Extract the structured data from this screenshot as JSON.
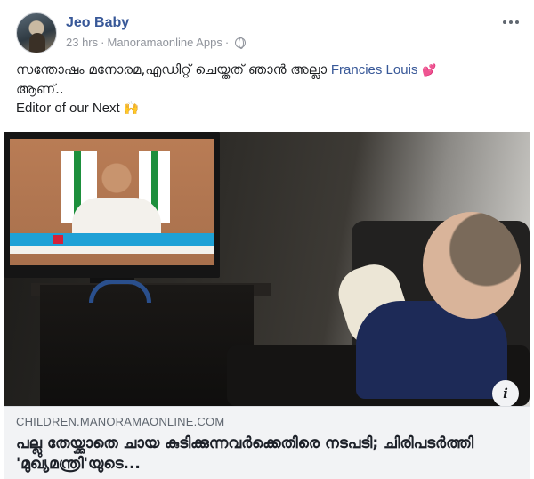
{
  "post": {
    "author": "Jeo Baby",
    "time": "23 hrs",
    "separator": "·",
    "app": "Manoramaonline Apps",
    "privacy_icon": "globe-icon",
    "more_icon": "more-horizontal-icon",
    "text": {
      "line1": "സന്തോഷം മനോരമ,എഡിറ്റ് ചെയ്തത് ഞാൻ അല്ലാ",
      "mention": "Francies Louis",
      "heart_emoji": "💕",
      "line2": "ആണ്..",
      "line3": "Editor of our Next",
      "hands_emoji": "🙌"
    }
  },
  "link_preview": {
    "info_icon": "info-icon",
    "info_label": "i",
    "domain": "CHILDREN.MANORAMAONLINE.COM",
    "title": "പല്ലു തേയ്ക്കാതെ ചായ കുടിക്കുന്നവർക്കെതിരെ നടപടി; ചിരിപടർത്തി 'മുഖ്യമന്ത്രി'യുടെ..."
  }
}
